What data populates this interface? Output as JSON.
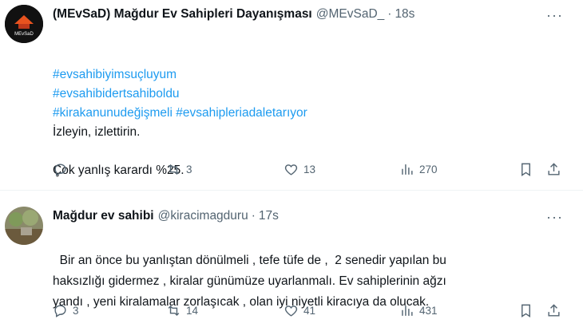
{
  "tweets": [
    {
      "name": "(MEvSaD) Mağdur Ev Sahipleri Dayanışması",
      "handle": "@MEvSaD_",
      "dot": "·",
      "time": "18s",
      "avatar_text": "MEvSaD",
      "hashtags": [
        "#evsahibiyimsuçluyum",
        "#evsahibidertsahiboldu",
        "#kirakanunudeğişmeli #evsahipleriadaletarıyor"
      ],
      "text": "İzleyin, izlettirin.\n\nÇok yanlış karardı %25.",
      "replies": "",
      "retweets": "3",
      "likes": "13",
      "views": "270"
    },
    {
      "name": "Mağdur ev sahibi",
      "handle": "@kiracimagduru",
      "dot": "·",
      "time": "17s",
      "text": "Bir an önce bu yanlıştan dönülmeli , tefe tüfe de ,  2 senedir yapılan bu\nhaksızlığı gidermez , kiralar günümüze uyarlanmalı. Ev sahiplerinin ağzı\nyandı , yeni kiralamalar zorlaşıcak , olan iyi niyetli kiracıya da olucak.",
      "replies": "3",
      "retweets": "14",
      "likes": "41",
      "views": "431"
    }
  ],
  "more_label": "···",
  "colors": {
    "link": "#1d9bf0",
    "muted": "#536471",
    "text": "#0f1419"
  },
  "icons": [
    "reply-icon",
    "retweet-icon",
    "like-icon",
    "views-icon",
    "bookmark-icon",
    "share-icon",
    "more-icon"
  ]
}
